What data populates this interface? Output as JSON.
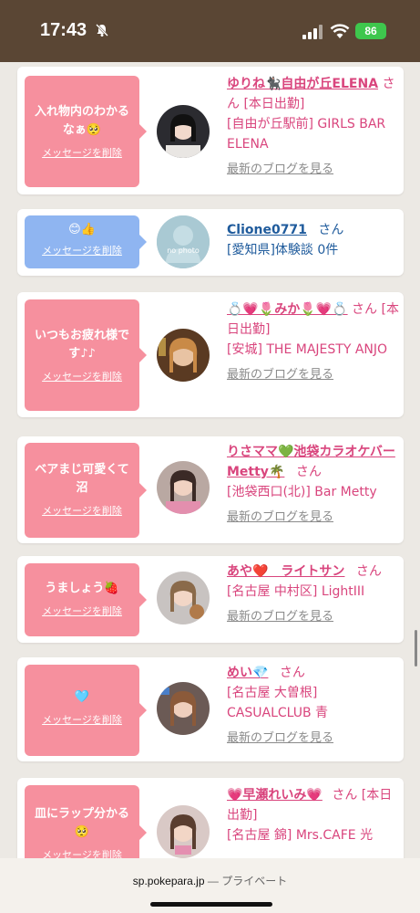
{
  "status": {
    "time": "17:43",
    "battery": "86"
  },
  "cards": [
    {
      "bubble_text": "入れ物内のわかるなぁ🥺",
      "delete_label": "メッセージを削除",
      "name": "ゆりね🐈‍⬛自由が丘ELENA",
      "honorific": "さん",
      "status": "[本日出勤]",
      "location": "[自由が丘駅前] GIRLS BAR ELENA",
      "blog_link": "最新のブログを見る"
    },
    {
      "bubble_text": "😊👍",
      "delete_label": "メッセージを削除",
      "name": "Clione0771",
      "honorific": "さん",
      "location": "[愛知県]体験談 0件",
      "avatar_text": "no photo"
    },
    {
      "bubble_text": "いつもお疲れ様です♪♪",
      "delete_label": "メッセージを削除",
      "name": "💍💗🌷みか🌷💗💍",
      "honorific": "さん",
      "status": "[本日出勤]",
      "location": "[安城] THE MAJESTY ANJO",
      "blog_link": "最新のブログを見る"
    },
    {
      "bubble_text": "ベアまじ可愛くて沼",
      "delete_label": "メッセージを削除",
      "name": "りさママ💚池袋カラオケバーMetty🌴",
      "honorific": "さん",
      "location": "[池袋西口(北)] Bar Metty",
      "blog_link": "最新のブログを見る"
    },
    {
      "bubble_text": "うましょう🍓",
      "delete_label": "メッセージを削除",
      "name": "あや❤️　ライトサン",
      "honorific": "さん",
      "location": "[名古屋 中村区] LightIII",
      "blog_link": "最新のブログを見る"
    },
    {
      "bubble_text": "🩵",
      "delete_label": "メッセージを削除",
      "name": "めい💎",
      "honorific": "さん",
      "location": "[名古屋 大曽根] CASUALCLUB 青",
      "blog_link": "最新のブログを見る"
    },
    {
      "bubble_text": "皿にラップ分かる🥺",
      "delete_label": "メッセージを削除",
      "name": "💗早瀬れいみ💗",
      "honorific": "さん",
      "status": "[本日出勤]",
      "location": "[名古屋 錦] Mrs.CAFE 光"
    }
  ],
  "browser": {
    "domain": "sp.pokepara.jp",
    "mode": " — プライベート"
  },
  "colors": {
    "bubble_pink": "#f6909e",
    "bubble_blue": "#8fb5f1",
    "name_pink": "#d9457d",
    "name_blue": "#1f5b9c",
    "status_bar": "#5a4634"
  }
}
